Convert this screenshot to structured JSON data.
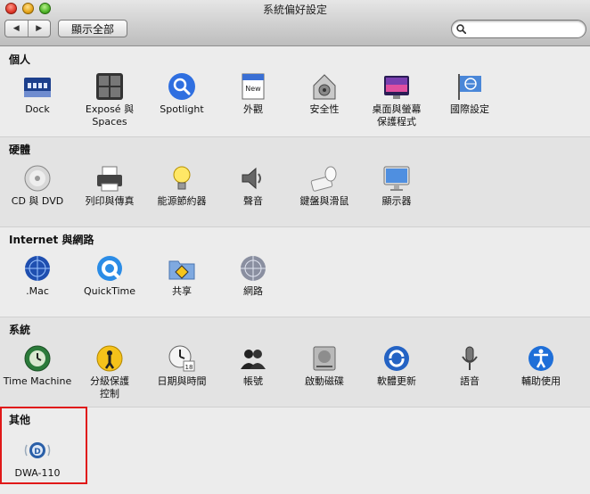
{
  "window": {
    "title": "系統偏好設定"
  },
  "toolbar": {
    "back": "◀",
    "forward": "▶",
    "show_all": "顯示全部",
    "search_value": ""
  },
  "sections": [
    {
      "title": "個人",
      "items": [
        {
          "label": "Dock",
          "icon": "dock-icon"
        },
        {
          "label": "Exposé 與\nSpaces",
          "icon": "expose-spaces-icon"
        },
        {
          "label": "Spotlight",
          "icon": "spotlight-icon"
        },
        {
          "label": "外觀",
          "icon": "appearance-icon"
        },
        {
          "label": "安全性",
          "icon": "security-icon"
        },
        {
          "label": "桌面與螢幕\n保護程式",
          "icon": "desktop-screensaver-icon"
        },
        {
          "label": "國際設定",
          "icon": "international-icon"
        }
      ]
    },
    {
      "title": "硬體",
      "items": [
        {
          "label": "CD 與 DVD",
          "icon": "cd-dvd-icon"
        },
        {
          "label": "列印與傳真",
          "icon": "print-fax-icon"
        },
        {
          "label": "能源節約器",
          "icon": "energy-saver-icon"
        },
        {
          "label": "聲音",
          "icon": "sound-icon"
        },
        {
          "label": "鍵盤與滑鼠",
          "icon": "keyboard-mouse-icon"
        },
        {
          "label": "顯示器",
          "icon": "displays-icon"
        }
      ]
    },
    {
      "title": "Internet 與網路",
      "items": [
        {
          "label": ".Mac",
          "icon": "dotmac-icon"
        },
        {
          "label": "QuickTime",
          "icon": "quicktime-icon"
        },
        {
          "label": "共享",
          "icon": "sharing-icon"
        },
        {
          "label": "網路",
          "icon": "network-icon"
        }
      ]
    },
    {
      "title": "系統",
      "items": [
        {
          "label": "Time Machine",
          "icon": "time-machine-icon"
        },
        {
          "label": "分級保護\n控制",
          "icon": "parental-controls-icon"
        },
        {
          "label": "日期與時間",
          "icon": "date-time-icon"
        },
        {
          "label": "帳號",
          "icon": "accounts-icon"
        },
        {
          "label": "啟動磁碟",
          "icon": "startup-disk-icon"
        },
        {
          "label": "軟體更新",
          "icon": "software-update-icon"
        },
        {
          "label": "語音",
          "icon": "speech-icon"
        },
        {
          "label": "輔助使用",
          "icon": "universal-access-icon"
        }
      ]
    },
    {
      "title": "其他",
      "items": [
        {
          "label": "DWA-110",
          "icon": "dwa110-icon"
        }
      ]
    }
  ],
  "colors": {
    "highlight": "#e01818",
    "accent": "#1f5fd1"
  }
}
